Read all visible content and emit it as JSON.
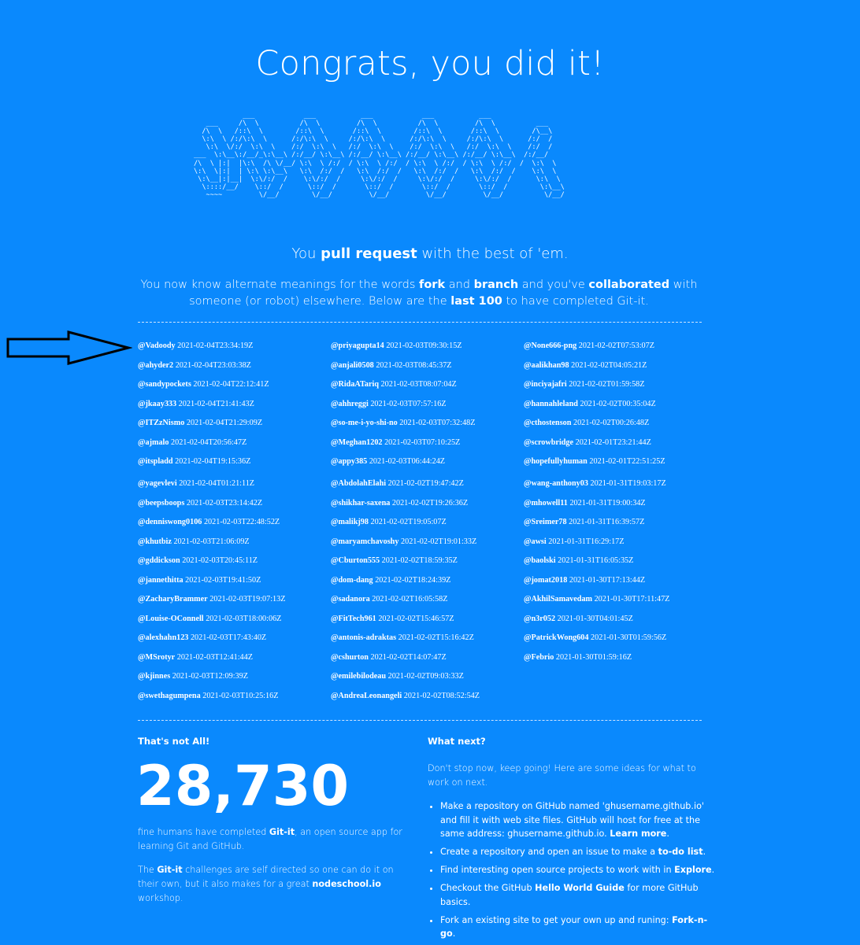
{
  "title": "Congrats, you did it!",
  "ascii_art": "            ___            ___           ___            ___           ___\n   ___     /\\  \\          /\\  \\         /\\  \\          /\\  \\         /\\  \\          ___\n  /\\  \\   /::\\  \\        /::\\  \\       /::\\  \\        /::\\  \\       /::\\  \\        /\\__\\\n  \\:\\  \\ /:/\\:\\  \\      /:/\\:\\  \\     /:/\\:\\  \\      /:/\\:\\  \\     /:/\\:\\  \\      /:/  /\n   \\:\\  \\/:/  \\:\\  \\    /:/  \\:\\  \\   /:/  \\:\\  \\    /:/  \\:\\  \\   /:/  \\:\\  \\    /:/  /\n___  \\:\\__\\:/__/_\\:\\__\\ /:/__/ \\:\\__\\ /:/__/ \\:\\__\\ /:/__/ \\:\\__\\ /:/__/ \\:\\__\\  /:/__/\n/\\  \\ |:|  |\\:\\  /\\ \\/__/ \\:\\  \\ /:/  / \\:\\  \\ /:/  / \\:\\  \\ /:/  / \\:\\  \\ /:/  /  \\:\\  \\\n\\:\\  \\|:|  | \\:\\ \\:\\__\\   \\:\\  /:/  /   \\:\\  /:/  /   \\:\\  /:/  /   \\:\\  /:/  /    \\:\\  \\\n \\:\\__|:|__|  \\:\\/:/  /    \\:\\/:/  /     \\:\\/:/  /     \\:\\/:/  /     \\:\\/:/  /      \\:\\  \\\n  \\::::/__/    \\::/  /      \\::/  /       \\::/  /       \\::/  /       \\::/  /        \\:\\__\\\n   ~~~~         \\/__/        \\/__/         \\/__/         \\/__/         \\/__/          \\/__/",
  "tagline": {
    "pre": "You ",
    "bold": "pull request",
    "post": " with the best of 'em."
  },
  "intro": {
    "p1": "You now know alternate meanings for the words ",
    "fork": "fork",
    "p2": " and ",
    "branch": "branch",
    "p3": " and you've ",
    "collaborated": "collaborated",
    "p4": " with someone (or robot) elsewhere. Below are the ",
    "last": "last 100",
    "p5": " to have completed Git-it."
  },
  "completers": [
    [
      {
        "user": "@Vadoody",
        "time": "2021-02-04T23:34:19Z"
      },
      {
        "user": "@ahyder2",
        "time": "2021-02-04T23:03:38Z"
      },
      {
        "user": "@sandypockets",
        "time": "2021-02-04T22:12:41Z"
      },
      {
        "user": "@jkaay333",
        "time": "2021-02-04T21:41:43Z"
      },
      {
        "user": "@ITZzNismo",
        "time": "2021-02-04T21:29:09Z"
      },
      {
        "user": "@ajmalo",
        "time": "2021-02-04T20:56:47Z"
      },
      {
        "user": "@itspladd",
        "time": "2021-02-04T19:15:36Z"
      },
      {
        "user": "@yagevlevi",
        "time": "2021-02-04T01:21:11Z"
      },
      {
        "user": "@beepsboops",
        "time": "2021-02-03T23:14:42Z"
      },
      {
        "user": "@denniswong0106",
        "time": "2021-02-03T22:48:52Z"
      },
      {
        "user": "@khutbiz",
        "time": "2021-02-03T21:06:09Z"
      },
      {
        "user": "@gddickson",
        "time": "2021-02-03T20:45:11Z"
      },
      {
        "user": "@jannethitta",
        "time": "2021-02-03T19:41:50Z"
      },
      {
        "user": "@ZacharyBrammer",
        "time": "2021-02-03T19:07:13Z"
      },
      {
        "user": "@Louise-OConnell",
        "time": "2021-02-03T18:00:06Z"
      },
      {
        "user": "@alexhahn123",
        "time": "2021-02-03T17:43:40Z"
      },
      {
        "user": "@MSrotyr",
        "time": "2021-02-03T12:41:44Z"
      },
      {
        "user": "@kjinnes",
        "time": "2021-02-03T12:09:39Z"
      },
      {
        "user": "@swethagumpena",
        "time": "2021-02-03T10:25:16Z"
      }
    ],
    [
      {
        "user": "@priyagupta14",
        "time": "2021-02-03T09:30:15Z"
      },
      {
        "user": "@anjali0508",
        "time": "2021-02-03T08:45:37Z"
      },
      {
        "user": "@RidaATariq",
        "time": "2021-02-03T08:07:04Z"
      },
      {
        "user": "@ahhreggi",
        "time": "2021-02-03T07:57:16Z"
      },
      {
        "user": "@so-me-i-yo-shi-no",
        "time": "2021-02-03T07:32:48Z"
      },
      {
        "user": "@Meghan1202",
        "time": "2021-02-03T07:10:25Z"
      },
      {
        "user": "@appy385",
        "time": "2021-02-03T06:44:24Z"
      },
      {
        "user": "@AbdolahElahi",
        "time": "2021-02-02T19:47:42Z"
      },
      {
        "user": "@shikhar-saxena",
        "time": "2021-02-02T19:26:36Z"
      },
      {
        "user": "@malikj98",
        "time": "2021-02-02T19:05:07Z"
      },
      {
        "user": "@maryamchavoshy",
        "time": "2021-02-02T19:01:33Z"
      },
      {
        "user": "@Cburton555",
        "time": "2021-02-02T18:59:35Z"
      },
      {
        "user": "@dom-dang",
        "time": "2021-02-02T18:24:39Z"
      },
      {
        "user": "@sadanora",
        "time": "2021-02-02T16:05:58Z"
      },
      {
        "user": "@FitTech961",
        "time": "2021-02-02T15:46:57Z"
      },
      {
        "user": "@antonis-adraktas",
        "time": "2021-02-02T15:16:42Z"
      },
      {
        "user": "@cshurton",
        "time": "2021-02-02T14:07:47Z"
      },
      {
        "user": "@emilebilodeau",
        "time": "2021-02-02T09:03:33Z"
      },
      {
        "user": "@AndreaLeonangeli",
        "time": "2021-02-02T08:52:54Z"
      }
    ],
    [
      {
        "user": "@None666-png",
        "time": "2021-02-02T07:53:07Z"
      },
      {
        "user": "@aalikhan98",
        "time": "2021-02-02T04:05:21Z"
      },
      {
        "user": "@inciyajafri",
        "time": "2021-02-02T01:59:58Z"
      },
      {
        "user": "@hannahleland",
        "time": "2021-02-02T00:35:04Z"
      },
      {
        "user": "@cthostenson",
        "time": "2021-02-02T00:26:48Z"
      },
      {
        "user": "@scrowbridge",
        "time": "2021-02-01T23:21:44Z"
      },
      {
        "user": "@hopefullyhuman",
        "time": "2021-02-01T22:51:25Z"
      },
      {
        "user": "@wang-anthony03",
        "time": "2021-01-31T19:03:17Z"
      },
      {
        "user": "@mhowell11",
        "time": "2021-01-31T19:00:34Z"
      },
      {
        "user": "@Sreimer78",
        "time": "2021-01-31T16:39:57Z"
      },
      {
        "user": "@awsi",
        "time": "2021-01-31T16:29:17Z"
      },
      {
        "user": "@baolski",
        "time": "2021-01-31T16:05:35Z"
      },
      {
        "user": "@jomat2018",
        "time": "2021-01-30T17:13:44Z"
      },
      {
        "user": "@AkhilSamavedam",
        "time": "2021-01-30T17:11:47Z"
      },
      {
        "user": "@n3r052",
        "time": "2021-01-30T04:01:45Z"
      },
      {
        "user": "@PatrickWong604",
        "time": "2021-01-30T01:59:56Z"
      },
      {
        "user": "@Febrio",
        "time": "2021-01-30T01:59:16Z"
      }
    ]
  ],
  "stats": {
    "heading": "That's not All!",
    "count": "28,730",
    "desc_pre": "fine humans have completed ",
    "gitit": "Git-it",
    "desc_post": ", an open source app for learning Git and GitHub.",
    "p2_pre": "The ",
    "p2_gitit": "Git-it",
    "p2_mid": " challenges are self directed so one can do it on their own, but it also makes for a great ",
    "p2_ns": "nodeschool.io",
    "p2_post": " workshop."
  },
  "next": {
    "heading": "What next?",
    "intro": "Don't stop now, keep going! Here are some ideas for what to work on next.",
    "items": [
      {
        "pre": "Make a repository on GitHub named 'ghusername.github.io' and fill it with web site files. GitHub will host for free at the same address: ghusername.github.io. ",
        "link": "Learn more",
        "post": "."
      },
      {
        "pre": "Create a repository and open an issue to make a ",
        "link": "to-do list",
        "post": "."
      },
      {
        "pre": "Find interesting open source projects to work with in ",
        "link": "Explore",
        "post": "."
      },
      {
        "pre": "Checkout the GitHub ",
        "link": "Hello World Guide",
        "post": " for more GitHub basics."
      },
      {
        "pre": "Fork an existing site to get your own up and runing: ",
        "link": "Fork-n-go",
        "post": "."
      }
    ]
  },
  "colors": {
    "background": "#0a89fd",
    "text": "#ffffff",
    "annotation_arrow": "#000000"
  }
}
